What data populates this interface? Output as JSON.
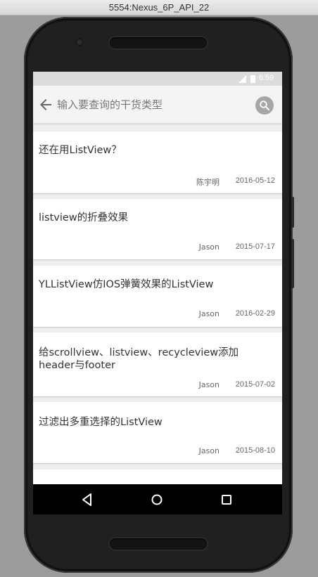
{
  "window": {
    "title": "5554:Nexus_6P_API_22"
  },
  "statusbar": {
    "time": "6:59"
  },
  "search": {
    "placeholder": "输入要查询的干货类型"
  },
  "articles": [
    {
      "title": "还在用ListView？",
      "author": "陈宇明",
      "date": "2016-05-12"
    },
    {
      "title": "listview的折叠效果",
      "author": "Jason",
      "date": "2015-07-17"
    },
    {
      "title": "YLListView仿IOS弹簧效果的ListView",
      "author": "Jason",
      "date": "2016-02-29"
    },
    {
      "title": "给scrollview、listview、recycleview添加header与footer",
      "author": "Jason",
      "date": "2015-07-02"
    },
    {
      "title": "过滤出多重选择的ListView",
      "author": "Jason",
      "date": "2015-08-10"
    }
  ],
  "icons": {
    "back": "back-arrow-icon",
    "search": "search-icon",
    "nav_back": "triangle-back-icon",
    "nav_home": "circle-home-icon",
    "nav_recents": "square-recents-icon"
  },
  "colors": {
    "card_bg": "#ffffff",
    "page_bg": "#efefef",
    "search_btn": "#a6a6a6"
  }
}
